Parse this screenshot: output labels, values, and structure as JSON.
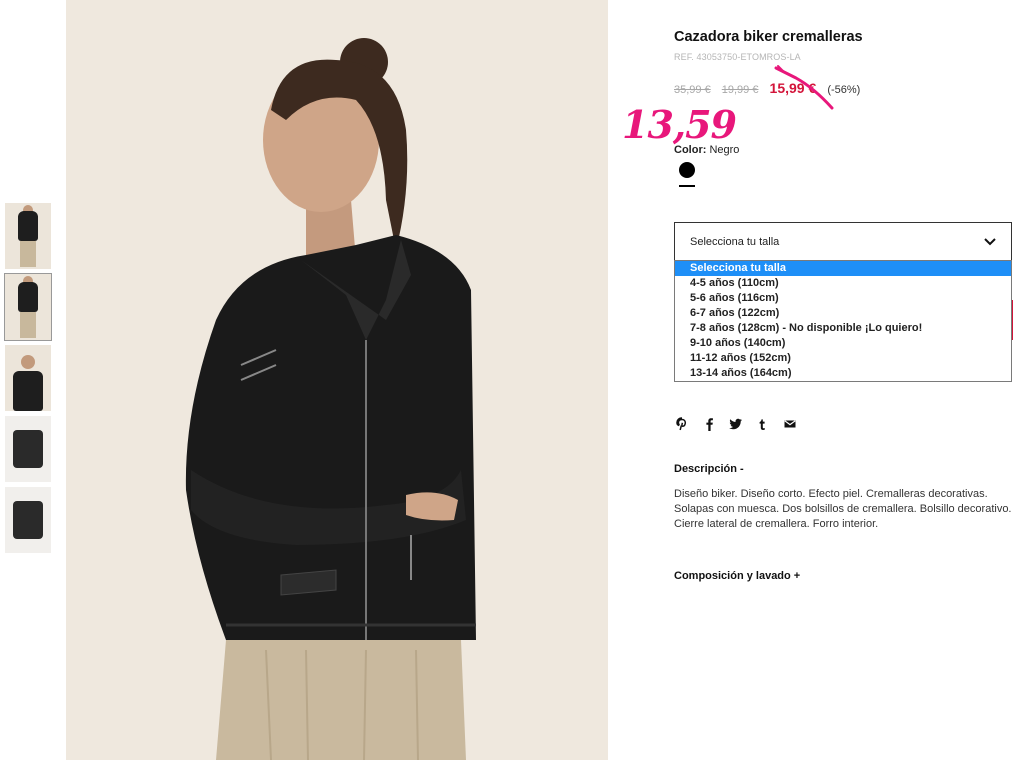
{
  "product": {
    "title": "Cazadora biker cremalleras",
    "ref": "REF. 43053750-ETOMROS-LA",
    "price_original": "35,99 €",
    "price_previous": "19,99 €",
    "price_sale": "15,99 €",
    "discount": "(-56%)",
    "handwritten_price": "13,59",
    "color_label": "Color:",
    "color_value": "Negro",
    "swatch_color": "#000000"
  },
  "size_select": {
    "label": "Selecciona tu talla",
    "options": [
      "Selecciona tu talla",
      "4-5 años (110cm)",
      "5-6 años (116cm)",
      "6-7 años (122cm)",
      "7-8 años (128cm) - No disponible ¡Lo quiero!",
      "9-10 años (140cm)",
      "11-12 años (152cm)",
      "13-14 años (164cm)"
    ],
    "selected_index": 0
  },
  "share_icons": [
    "pinterest-icon",
    "facebook-icon",
    "twitter-icon",
    "tumblr-icon",
    "mail-icon"
  ],
  "description": {
    "heading": "Descripción -",
    "text": "Diseño biker. Diseño corto. Efecto piel. Cremalleras decorativas. Solapas con muesca. Dos bolsillos de cremallera. Bolsillo decorativo. Cierre lateral de cremallera. Forro interior."
  },
  "composition": {
    "heading": "Composición y lavado +"
  },
  "colors": {
    "sale": "#d3143a",
    "handwritten": "#e8177b",
    "dropdown_highlight": "#1e8ff7",
    "image_background": "#efe8de"
  }
}
